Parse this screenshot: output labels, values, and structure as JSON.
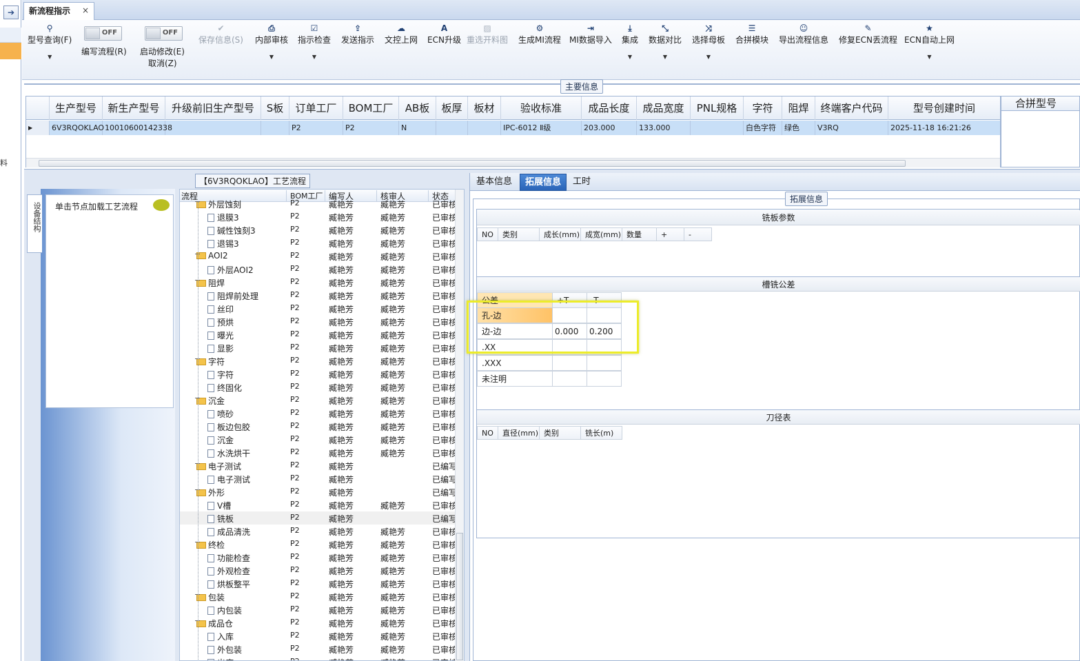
{
  "app": {
    "tab_title": "新流程指示",
    "tab_close": "×",
    "exit_icon": "exit-icon",
    "strip_char": "料"
  },
  "toolbar": {
    "query": "型号查询(F)",
    "edit_flow": "编写流程(R)",
    "edit_flow_toggle": "OFF",
    "start_modify": "启动修改(E)",
    "start_modify_toggle": "OFF",
    "cancel": "取消(Z)",
    "save_info": "保存信息(S)",
    "internal_review": "内部审核",
    "indication_check": "指示检查",
    "send_indication": "发送指示",
    "doc_control_upload": "文控上网",
    "ecn_upgrade": "ECN升级",
    "reselect_drawing": "重选开料图",
    "gen_mi_flow": "生成MI流程",
    "mi_import": "MI数据导入",
    "integrate": "集成",
    "data_compare": "数据对比",
    "select_mother_board": "选择母板",
    "merge_module": "合拼模块",
    "export_flow_info": "导出流程信息",
    "fix_ecn_flow": "修复ECN丢流程",
    "ecn_auto_upload": "ECN自动上网"
  },
  "main_info": {
    "title": "主要信息",
    "columns": [
      "生产型号",
      "新生产型号",
      "升级前旧生产型号",
      "S板",
      "订单工厂",
      "BOM工厂",
      "AB板",
      "板厚",
      "板材",
      "验收标准",
      "成品长度",
      "成品宽度",
      "PNL规格",
      "字符",
      "阻焊",
      "终端客户代码",
      "型号创建时间"
    ],
    "row": [
      "6V3RQOKLAO",
      "10010600142338",
      "",
      "",
      "P2",
      "P2",
      "N",
      "",
      "",
      "IPC-6012 Ⅱ级",
      "203.000",
      "133.000",
      "",
      "白色字符",
      "绿色",
      "V3RQ",
      "2025-11-18 16:21:26"
    ],
    "merge_header": "合拼型号"
  },
  "process": {
    "title": "【6V3RQOKLAO】工艺流程",
    "side_tab": "设备结构",
    "load_hint": "单击节点加载工艺流程",
    "headers": [
      "流程",
      "BOM工厂",
      "编写人",
      "核审人",
      "状态"
    ],
    "rows": [
      {
        "level": 1,
        "type": "folder",
        "name": "外层蚀刻",
        "code": "P2",
        "writer": "臧艳芳",
        "reviewer": "臧艳芳",
        "status": "已审核"
      },
      {
        "level": 2,
        "type": "doc",
        "name": "退膜3",
        "code": "P2",
        "writer": "臧艳芳",
        "reviewer": "臧艳芳",
        "status": "已审核"
      },
      {
        "level": 2,
        "type": "doc",
        "name": "碱性蚀刻3",
        "code": "P2",
        "writer": "臧艳芳",
        "reviewer": "臧艳芳",
        "status": "已审核"
      },
      {
        "level": 2,
        "type": "doc",
        "name": "退锡3",
        "code": "P2",
        "writer": "臧艳芳",
        "reviewer": "臧艳芳",
        "status": "已审核"
      },
      {
        "level": 1,
        "type": "folder",
        "name": "AOI2",
        "code": "P2",
        "writer": "臧艳芳",
        "reviewer": "臧艳芳",
        "status": "已审核"
      },
      {
        "level": 2,
        "type": "doc",
        "name": "外层AOI2",
        "code": "P2",
        "writer": "臧艳芳",
        "reviewer": "臧艳芳",
        "status": "已审核"
      },
      {
        "level": 1,
        "type": "folder",
        "name": "阻焊",
        "code": "P2",
        "writer": "臧艳芳",
        "reviewer": "臧艳芳",
        "status": "已审核"
      },
      {
        "level": 2,
        "type": "doc",
        "name": "阻焊前处理",
        "code": "P2",
        "writer": "臧艳芳",
        "reviewer": "臧艳芳",
        "status": "已审核"
      },
      {
        "level": 2,
        "type": "doc",
        "name": "丝印",
        "code": "P2",
        "writer": "臧艳芳",
        "reviewer": "臧艳芳",
        "status": "已审核"
      },
      {
        "level": 2,
        "type": "doc",
        "name": "预烘",
        "code": "P2",
        "writer": "臧艳芳",
        "reviewer": "臧艳芳",
        "status": "已审核"
      },
      {
        "level": 2,
        "type": "doc",
        "name": "曝光",
        "code": "P2",
        "writer": "臧艳芳",
        "reviewer": "臧艳芳",
        "status": "已审核"
      },
      {
        "level": 2,
        "type": "doc",
        "name": "显影",
        "code": "P2",
        "writer": "臧艳芳",
        "reviewer": "臧艳芳",
        "status": "已审核"
      },
      {
        "level": 1,
        "type": "folder",
        "name": "字符",
        "code": "P2",
        "writer": "臧艳芳",
        "reviewer": "臧艳芳",
        "status": "已审核"
      },
      {
        "level": 2,
        "type": "doc",
        "name": "字符",
        "code": "P2",
        "writer": "臧艳芳",
        "reviewer": "臧艳芳",
        "status": "已审核"
      },
      {
        "level": 2,
        "type": "doc",
        "name": "终固化",
        "code": "P2",
        "writer": "臧艳芳",
        "reviewer": "臧艳芳",
        "status": "已审核"
      },
      {
        "level": 1,
        "type": "folder",
        "name": "沉金",
        "code": "P2",
        "writer": "臧艳芳",
        "reviewer": "臧艳芳",
        "status": "已审核"
      },
      {
        "level": 2,
        "type": "doc",
        "name": "喷砂",
        "code": "P2",
        "writer": "臧艳芳",
        "reviewer": "臧艳芳",
        "status": "已审核"
      },
      {
        "level": 2,
        "type": "doc",
        "name": "板边包胶",
        "code": "P2",
        "writer": "臧艳芳",
        "reviewer": "臧艳芳",
        "status": "已审核"
      },
      {
        "level": 2,
        "type": "doc",
        "name": "沉金",
        "code": "P2",
        "writer": "臧艳芳",
        "reviewer": "臧艳芳",
        "status": "已审核"
      },
      {
        "level": 2,
        "type": "doc",
        "name": "水洗烘干",
        "code": "P2",
        "writer": "臧艳芳",
        "reviewer": "臧艳芳",
        "status": "已审核"
      },
      {
        "level": 1,
        "type": "folder",
        "name": "电子测试",
        "code": "P2",
        "writer": "臧艳芳",
        "reviewer": "",
        "status": "已编写"
      },
      {
        "level": 2,
        "type": "doc",
        "name": "电子测试",
        "code": "P2",
        "writer": "臧艳芳",
        "reviewer": "",
        "status": "已编写"
      },
      {
        "level": 1,
        "type": "folder",
        "name": "外形",
        "code": "P2",
        "writer": "臧艳芳",
        "reviewer": "",
        "status": "已编写"
      },
      {
        "level": 2,
        "type": "doc",
        "name": "V槽",
        "code": "P2",
        "writer": "臧艳芳",
        "reviewer": "臧艳芳",
        "status": "已审核"
      },
      {
        "level": 2,
        "type": "doc",
        "name": "铣板",
        "code": "P2",
        "writer": "臧艳芳",
        "reviewer": "",
        "status": "已编写",
        "selected": true
      },
      {
        "level": 2,
        "type": "doc",
        "name": "成品清洗",
        "code": "P2",
        "writer": "臧艳芳",
        "reviewer": "臧艳芳",
        "status": "已审核"
      },
      {
        "level": 1,
        "type": "folder",
        "name": "终检",
        "code": "P2",
        "writer": "臧艳芳",
        "reviewer": "臧艳芳",
        "status": "已审核"
      },
      {
        "level": 2,
        "type": "doc",
        "name": "功能检查",
        "code": "P2",
        "writer": "臧艳芳",
        "reviewer": "臧艳芳",
        "status": "已审核"
      },
      {
        "level": 2,
        "type": "doc",
        "name": "外观检查",
        "code": "P2",
        "writer": "臧艳芳",
        "reviewer": "臧艳芳",
        "status": "已审核"
      },
      {
        "level": 2,
        "type": "doc",
        "name": "烘板整平",
        "code": "P2",
        "writer": "臧艳芳",
        "reviewer": "臧艳芳",
        "status": "已审核"
      },
      {
        "level": 1,
        "type": "folder",
        "name": "包装",
        "code": "P2",
        "writer": "臧艳芳",
        "reviewer": "臧艳芳",
        "status": "已审核"
      },
      {
        "level": 2,
        "type": "doc",
        "name": "内包装",
        "code": "P2",
        "writer": "臧艳芳",
        "reviewer": "臧艳芳",
        "status": "已审核"
      },
      {
        "level": 1,
        "type": "folder",
        "name": "成品仓",
        "code": "P2",
        "writer": "臧艳芳",
        "reviewer": "臧艳芳",
        "status": "已审核"
      },
      {
        "level": 2,
        "type": "doc",
        "name": "入库",
        "code": "P2",
        "writer": "臧艳芳",
        "reviewer": "臧艳芳",
        "status": "已审核"
      },
      {
        "level": 2,
        "type": "doc",
        "name": "外包装",
        "code": "P2",
        "writer": "臧艳芳",
        "reviewer": "臧艳芳",
        "status": "已审核"
      },
      {
        "level": 2,
        "type": "doc",
        "name": "出库",
        "code": "P2",
        "writer": "臧艳芳",
        "reviewer": "臧艳芳",
        "status": "已审核"
      }
    ]
  },
  "right": {
    "tabs": [
      "基本信息",
      "拓展信息",
      "工时"
    ],
    "ext_title": "拓展信息",
    "mill_params": {
      "title": "铣板参数",
      "headers": [
        "NO",
        "类别",
        "成长(mm)",
        "成宽(mm)",
        "数量",
        "+",
        "-"
      ]
    },
    "slot_tolerance": {
      "title": "槽铣公差",
      "headers": [
        "公差",
        "+T",
        "-T"
      ],
      "rows": [
        {
          "label": "孔-边",
          "plus": "",
          "minus": ""
        },
        {
          "label": "边-边",
          "plus": "0.000",
          "minus": "0.200"
        },
        {
          "label": ".XX",
          "plus": "",
          "minus": ""
        },
        {
          "label": ".XXX",
          "plus": "",
          "minus": ""
        },
        {
          "label": "未注明",
          "plus": "",
          "minus": ""
        }
      ]
    },
    "tool_table": {
      "title": "刀径表",
      "headers": [
        "NO",
        "直径(mm)",
        "类别",
        "铣长(m)"
      ]
    }
  }
}
